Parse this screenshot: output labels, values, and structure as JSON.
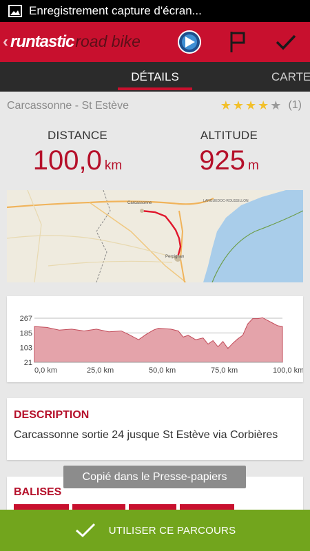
{
  "status_bar": {
    "notification_icon": "image-icon",
    "text": "Enregistrement capture d'écran..."
  },
  "app_bar": {
    "back_glyph": "‹",
    "brand": "runtastic",
    "product": "road bike",
    "actions": [
      "sync-icon",
      "flag-icon",
      "check-icon"
    ]
  },
  "tabs": [
    {
      "label": "DÉTAILS",
      "active": true
    },
    {
      "label": "CARTE",
      "active": false
    }
  ],
  "route": {
    "name": "Carcassonne - St Estève",
    "rating": 4,
    "rating_max": 5,
    "rating_count": "(1)"
  },
  "stats": {
    "distance": {
      "label": "DISTANCE",
      "value": "100,0",
      "unit": "km"
    },
    "altitude": {
      "label": "ALTITUDE",
      "value": "925",
      "unit": "m"
    }
  },
  "map": {
    "labels": [
      "Carcassonne",
      "LANGUEDOC-ROUSSILLON",
      "Perpignan"
    ]
  },
  "elevation_chart": {
    "y_ticks": [
      "267",
      "185",
      "103",
      "21"
    ],
    "x_ticks": [
      "0,0 km",
      "25,0 km",
      "50,0 km",
      "75,0 km",
      "100,0 km"
    ],
    "fill_color": "#e4a3aa",
    "line_color": "#c24b59"
  },
  "description": {
    "title": "DESCRIPTION",
    "text": "Carcassonne sortie 24 jusque St Estève via Corbières"
  },
  "tags": {
    "title": "BALISES"
  },
  "toast": "Copié dans le Presse-papiers",
  "cta": {
    "icon": "check-icon",
    "label": "UTILISER CE PARCOURS"
  },
  "colors": {
    "brand_red": "#c8102e",
    "value_red": "#b5102a",
    "cta_green": "#72a51d"
  }
}
